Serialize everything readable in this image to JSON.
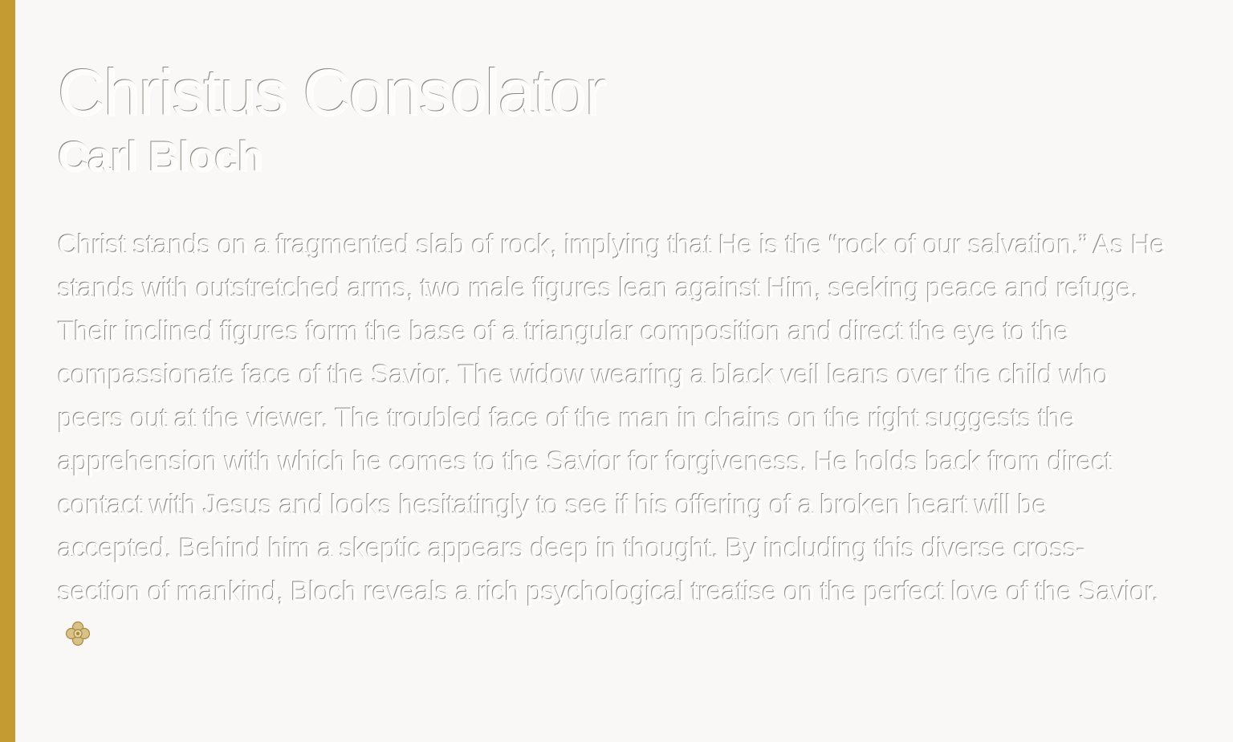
{
  "page": {
    "accent_color": "#c49a33",
    "background_color": "#f9f8f6"
  },
  "artwork": {
    "title": "Christus Consolator",
    "artist": "Carl Bloch",
    "description": "Christ stands on a fragmented slab of rock, implying that He is the “rock of our salvation.” As He stands with outstretched arms, two male figures lean against Him, seeking peace and refuge. Their inclined figures form the base of a triangular composition and direct the eye to the compassionate face of the Savior. The widow wearing a black veil leans over the child who peers out at the viewer. The troubled face of the man in chains on the right suggests the apprehension with which he comes to the Savior for forgiveness. He holds back from direct contact with Jesus and looks hesitatingly to see if his offering of a broken heart will be accepted. Behind him a skeptic appears deep in thought. By including this diverse cross-section of mankind, Bloch reveals a rich psychological treatise on the perfect love of the Savior.",
    "end_ornament_icon": "quatrefoil-ornament-icon"
  }
}
